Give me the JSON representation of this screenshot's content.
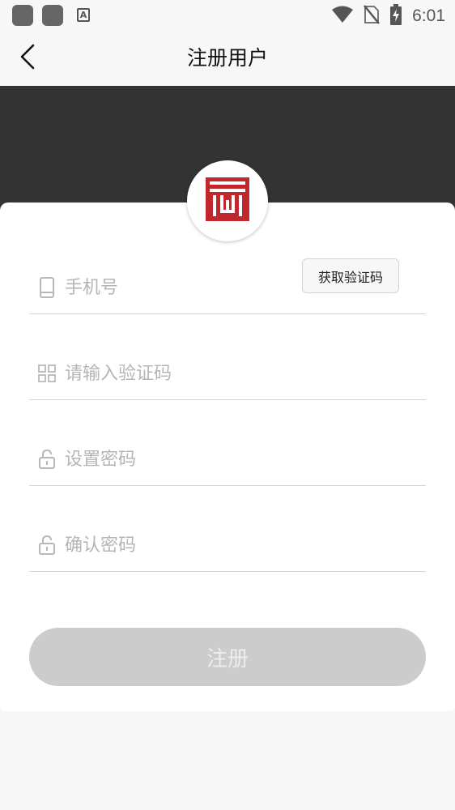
{
  "status_bar": {
    "time": "6:01",
    "icons": [
      "app-icon",
      "app-icon",
      "keyboard-a-icon",
      "wifi-icon",
      "no-sim-icon",
      "battery-charging-icon"
    ],
    "keyboard_letter": "A"
  },
  "nav": {
    "title": "注册用户",
    "back_icon": "chevron-left-icon"
  },
  "header": {
    "color": "#333333",
    "logo_color": "#c0282d",
    "logo_icon": "brand-logo-icon"
  },
  "form": {
    "phone": {
      "placeholder": "手机号",
      "value": "",
      "icon": "phone-icon"
    },
    "get_code_label": "获取验证码",
    "code": {
      "placeholder": "请输入验证码",
      "value": "",
      "icon": "grid-icon"
    },
    "password": {
      "placeholder": "设置密码",
      "value": "",
      "icon": "lock-icon"
    },
    "confirm_password": {
      "placeholder": "确认密码",
      "value": "",
      "icon": "lock-icon"
    },
    "submit_label": "注册"
  },
  "colors": {
    "background": "#f7f7f7",
    "card": "#ffffff",
    "divider": "#d4d4d4",
    "placeholder": "#b5b5b5",
    "button_disabled": "#cccccc"
  }
}
